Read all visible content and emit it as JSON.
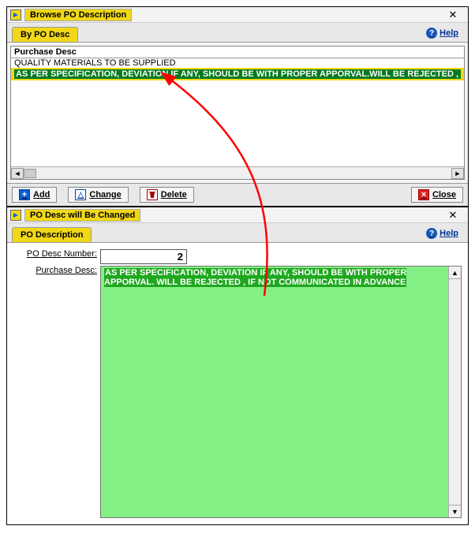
{
  "browse": {
    "title": "Browse PO Description",
    "tab_label": "By PO Desc",
    "help_label": "Help",
    "column_header": "Purchase Desc",
    "row_plain": "QUALITY MATERIALS TO BE SUPPLIED",
    "row_selected": "AS PER SPECIFICATION, DEVIATION IF ANY, SHOULD BE WITH PROPER APPORVAL.WILL BE REJECTED , IF NOT COMMUNICATED IN",
    "buttons": {
      "add": "Add",
      "change": "Change",
      "delete": "Delete",
      "close": "Close"
    }
  },
  "change": {
    "title": "PO Desc will Be Changed",
    "tab_label": "PO Description",
    "help_label": "Help",
    "number_label": "PO Desc Number:",
    "number_value": "2",
    "desc_label": "Purchase Desc:",
    "desc_value": "AS PER SPECIFICATION, DEVIATION IF ANY, SHOULD BE WITH PROPER APPORVAL. WILL BE REJECTED , IF NOT COMMUNICATED IN ADVANCE"
  }
}
